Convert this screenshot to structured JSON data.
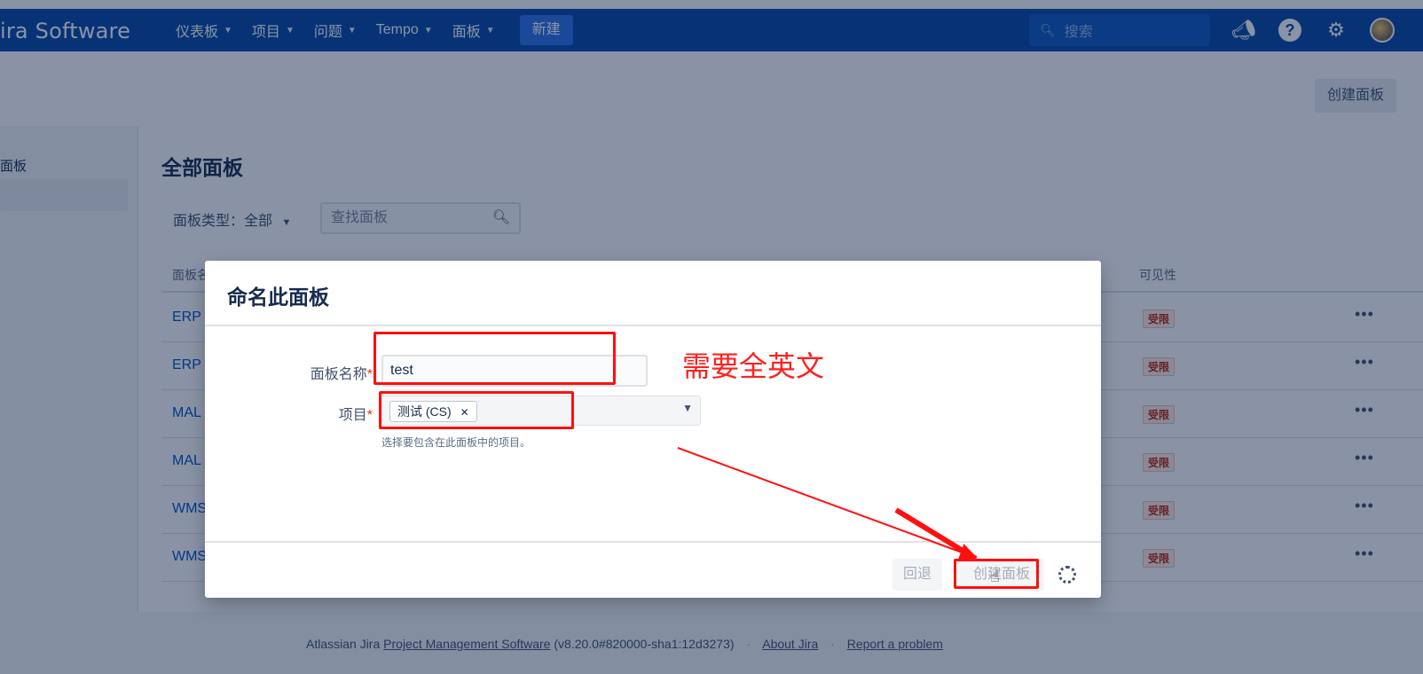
{
  "topnav": {
    "logo": "ira Software",
    "items": [
      {
        "label": "仪表板"
      },
      {
        "label": "项目"
      },
      {
        "label": "问题"
      },
      {
        "label": "Tempo"
      },
      {
        "label": "面板"
      }
    ],
    "new_label": "新建",
    "search_placeholder": "搜索"
  },
  "subheader": {
    "create_board_label": "创建面板"
  },
  "sidebar": {
    "label": "面板"
  },
  "content": {
    "title": "全部面板",
    "filter_type_label": "面板类型：全部",
    "filter_search_placeholder": "查找面板"
  },
  "table": {
    "col_name": "面板名",
    "col_visibility": "可见性",
    "rows": [
      {
        "name": "ERP",
        "visibility": "受限"
      },
      {
        "name": "ERP",
        "visibility": "受限"
      },
      {
        "name": "MAL",
        "visibility": "受限"
      },
      {
        "name": "MAL",
        "visibility": "受限"
      },
      {
        "name": "WMS",
        "visibility": "受限"
      },
      {
        "name": "WMS",
        "visibility": "受限"
      }
    ],
    "more_label": "•••"
  },
  "dialog": {
    "title": "命名此面板",
    "name_label": "面板名称",
    "name_value": "test",
    "project_label": "项目",
    "project_tag": "测试 (CS)",
    "project_help": "选择要包含在此面板中的项目。",
    "back_label": "回退",
    "create_label": "创建面板"
  },
  "annotation": {
    "note": "需要全英文",
    "color": "#ff0f0f"
  },
  "footer": {
    "prefix": "Atlassian Jira",
    "pm_link": "Project Management Software",
    "version": "(v8.20.0#820000-sha1:12d3273)",
    "about": "About Jira",
    "report": "Report a problem"
  }
}
